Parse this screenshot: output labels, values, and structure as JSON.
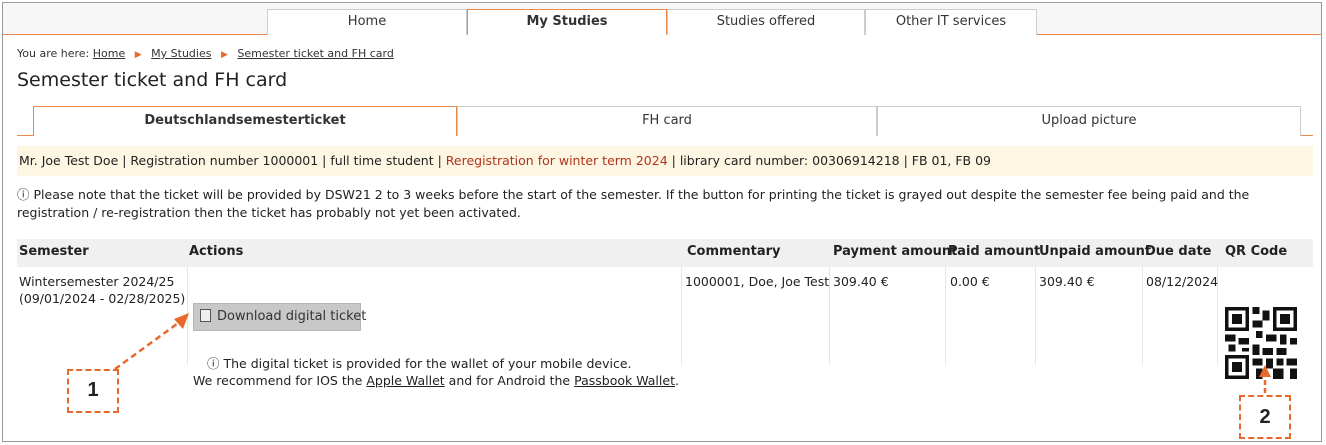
{
  "nav": {
    "tabs": [
      "Home",
      "My Studies",
      "Studies offered",
      "Other IT services"
    ]
  },
  "breadcrumb": {
    "prefix": "You are here:",
    "items": [
      "Home",
      "My Studies",
      "Semester ticket and FH card"
    ]
  },
  "page_title": "Semester ticket and FH card",
  "subtabs": [
    "Deutschlandsemesterticket",
    "FH card",
    "Upload picture"
  ],
  "infobar": {
    "part1": "Mr. Joe Test Doe | Registration number 1000001 | full time student | ",
    "rereg": "Reregistration for winter term 2024",
    "part2": " | library card number: 00306914218 | FB 01, FB 09"
  },
  "note": "Please note that the ticket will be provided by DSW21 2 to 3 weeks before the start of the semester. If the button for printing the ticket is grayed out despite the semester fee being paid and the registration / re-registration then the ticket has probably not yet been activated.",
  "table": {
    "headers": [
      "Semester",
      "Actions",
      "Commentary",
      "Payment amount",
      "Paid amount",
      "Unpaid amount",
      "Due date",
      "QR Code"
    ],
    "row": {
      "semester_line1": "Wintersemester 2024/25",
      "semester_line2": "(09/01/2024 - 02/28/2025)",
      "action_button": "Download digital ticket",
      "wallet_line1": "The digital ticket is provided for the wallet of your mobile device.",
      "wallet_prefix": "We recommend for IOS the",
      "apple_wallet": "Apple Wallet",
      "wallet_mid": "and for Android the",
      "passbook_wallet": "Passbook Wallet",
      "wallet_suffix": ".",
      "commentary": "1000001, Doe, Joe Test",
      "payment": "309.40 €",
      "paid": "0.00 €",
      "unpaid": "309.40 €",
      "due": "08/12/2024"
    }
  },
  "callouts": [
    "1",
    "2"
  ],
  "colors": {
    "accent": "#e8894b",
    "callout": "#e8692b",
    "infobar_bg": "#fdf6e3",
    "rereg_text": "#b0341c"
  },
  "icons": {
    "breadcrumb_separator": "chevron-right-icon",
    "info": "info-icon",
    "ticket": "ticket-icon",
    "qr": "qr-code-icon"
  }
}
